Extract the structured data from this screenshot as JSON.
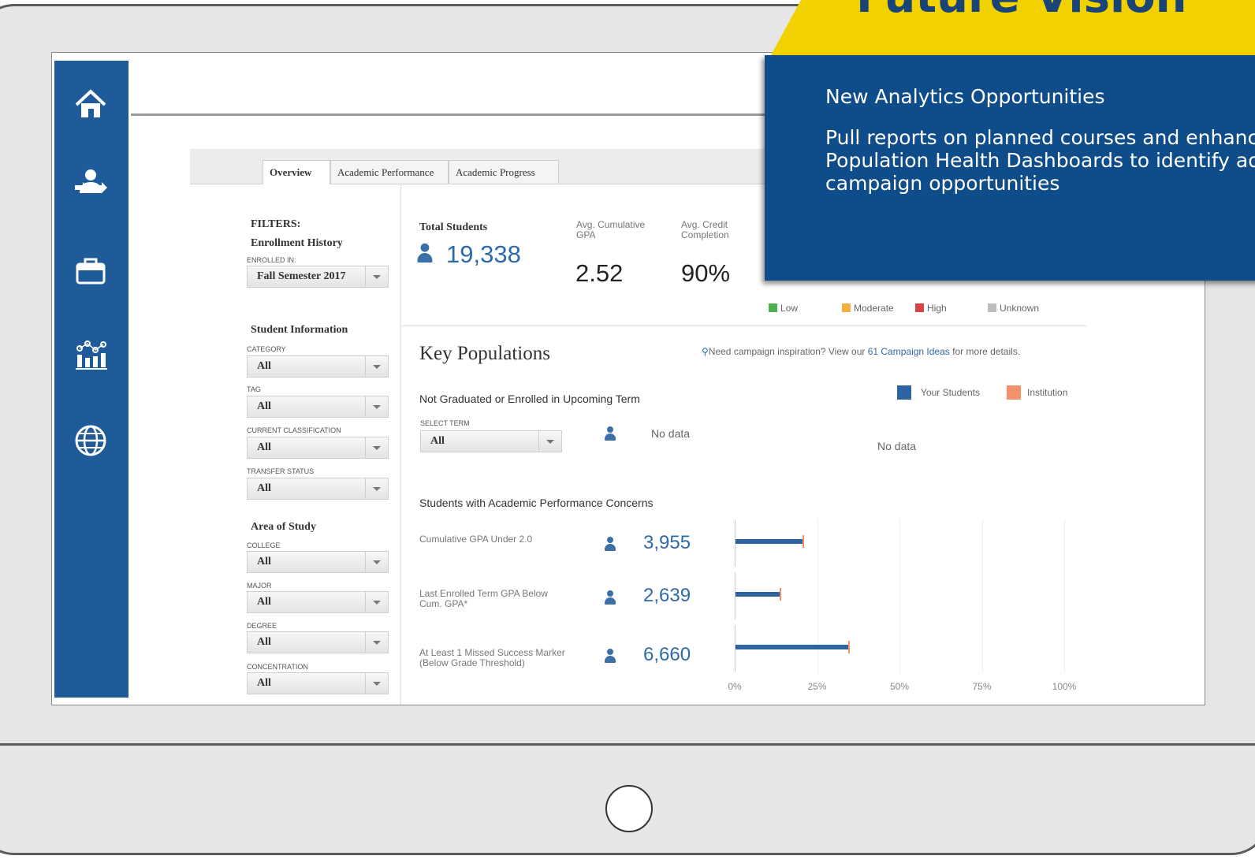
{
  "overlay": {
    "yellow_title": "Future Vision",
    "subtitle": "New Analytics Opportunities",
    "body": "Pull reports on planned courses and enhance Population Health Dashboards to identify additional campaign opportunities"
  },
  "tabs": [
    "Overview",
    "Academic Performance",
    "Academic Progress"
  ],
  "filters": {
    "title": "FILTERS:",
    "enrollment_history": "Enrollment History",
    "enrolled_in_label": "ENROLLED IN:",
    "enrolled_in_value": "Fall Semester 2017",
    "student_information": "Student Information",
    "category_label": "CATEGORY",
    "category_value": "All",
    "tag_label": "TAG",
    "tag_value": "All",
    "classification_label": "CURRENT CLASSIFICATION",
    "classification_value": "All",
    "transfer_label": "TRANSFER STATUS",
    "transfer_value": "All",
    "area_of_study": "Area of Study",
    "college_label": "COLLEGE",
    "college_value": "All",
    "major_label": "MAJOR",
    "major_value": "All",
    "degree_label": "DEGREE",
    "degree_value": "All",
    "concentration_label": "CONCENTRATION",
    "concentration_value": "All"
  },
  "stats": {
    "total_students_label": "Total Students",
    "total_students_value": "19,338",
    "gpa_label_1": "Avg. Cumulative",
    "gpa_label_2": "GPA",
    "gpa_value": "2.52",
    "credit_label_1": "Avg. Credit",
    "credit_label_2": "Completion",
    "credit_value": "90%"
  },
  "risk_legend": [
    {
      "label": "Low",
      "color": "#4caf50"
    },
    {
      "label": "Moderate",
      "color": "#f5b041"
    },
    {
      "label": "High",
      "color": "#d64545"
    },
    {
      "label": "Unknown",
      "color": "#bdbdbd"
    }
  ],
  "key_populations": {
    "title": "Key Populations",
    "inspiration_prefix": "Need campaign inspiration? View our ",
    "inspiration_link": "61 Campaign Ideas",
    "inspiration_suffix": " for more details.",
    "legend_yours": "Your Students",
    "legend_institution": "Institution",
    "not_graduated_title": "Not Graduated or Enrolled in Upcoming Term",
    "select_term_label": "SELECT TERM",
    "select_term_value": "All",
    "no_data_1": "No data",
    "no_data_2": "No data",
    "academic_concerns_title": "Students with Academic Performance Concerns",
    "metrics": [
      {
        "label_1": "Cumulative GPA Under 2.0",
        "label_2": "",
        "value": "3,955"
      },
      {
        "label_1": "Last Enrolled Term GPA Below",
        "label_2": "Cum. GPA*",
        "value": "2,639"
      },
      {
        "label_1": "At Least 1 Missed Success Marker",
        "label_2": "(Below Grade Threshold)",
        "value": "6,660"
      }
    ],
    "axis_ticks": [
      "0%",
      "25%",
      "50%",
      "75%",
      "100%"
    ]
  },
  "chart_data": {
    "type": "bar",
    "orientation": "horizontal",
    "categories": [
      "Cumulative GPA Under 2.0",
      "Last Enrolled Term GPA Below Cum. GPA*",
      "At Least 1 Missed Success Marker (Below Grade Threshold)"
    ],
    "series": [
      {
        "name": "Your Students",
        "values": [
          20.5,
          13.6,
          34.4
        ]
      },
      {
        "name": "Institution",
        "values": [
          20.5,
          13.6,
          34.4
        ]
      }
    ],
    "xlim": [
      0,
      100
    ],
    "x_tick_labels": [
      "0%",
      "25%",
      "50%",
      "75%",
      "100%"
    ],
    "colors": {
      "Your Students": "#2e63a2",
      "Institution": "#f4916b"
    }
  }
}
